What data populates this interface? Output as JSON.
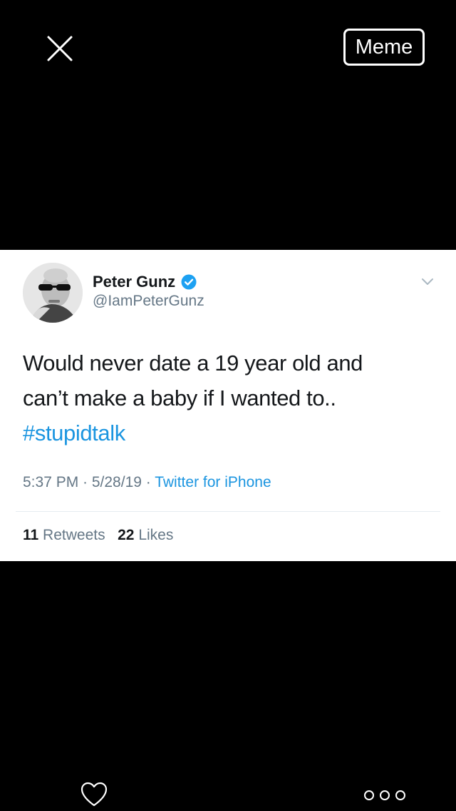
{
  "toolbar": {
    "close_icon": "close-icon",
    "meme_label": "Meme"
  },
  "tweet": {
    "display_name": "Peter Gunz",
    "verified": true,
    "handle": "@IamPeterGunz",
    "text_line1": "Would never date a 19 year old and",
    "text_line2": "can’t make a baby if I wanted to..",
    "hashtag": "#stupidtalk",
    "time": "5:37 PM · 5/28/19 · ",
    "source": "Twitter for iPhone",
    "retweets_count": "11",
    "retweets_label": "Retweets",
    "likes_count": "22",
    "likes_label": "Likes"
  },
  "bottom_bar": {
    "like_icon": "heart-icon",
    "more_icon": "more-icon"
  },
  "colors": {
    "background": "#000000",
    "card": "#ffffff",
    "link_blue": "#1b95e0",
    "verified_blue": "#1da1f2",
    "secondary_text": "#657786"
  }
}
